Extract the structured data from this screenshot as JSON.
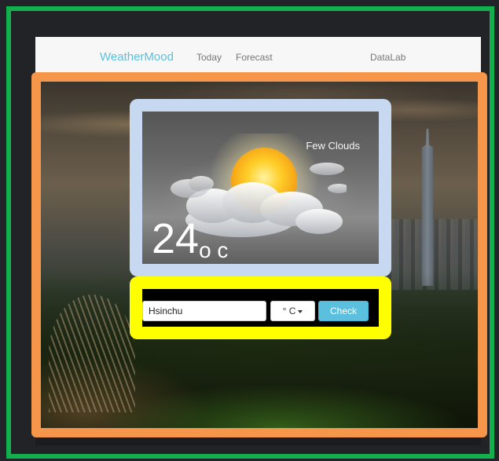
{
  "navbar": {
    "brand": "WeatherMood",
    "links": [
      "Today",
      "Forecast"
    ],
    "right_link": "DataLab"
  },
  "weather": {
    "condition": "Few Clouds",
    "temperature": "24",
    "temperature_unit": "o c",
    "icon": "sun-behind-clouds-icon"
  },
  "search": {
    "city_value": "Hsinchu",
    "unit_selected": "° C",
    "submit_label": "Check"
  },
  "colors": {
    "accent": "#5bc0de",
    "frame_green": "#12b04d",
    "frame_orange": "#f5964b",
    "frame_lightblue": "#c6d9f1",
    "frame_yellow": "#ffff00"
  }
}
